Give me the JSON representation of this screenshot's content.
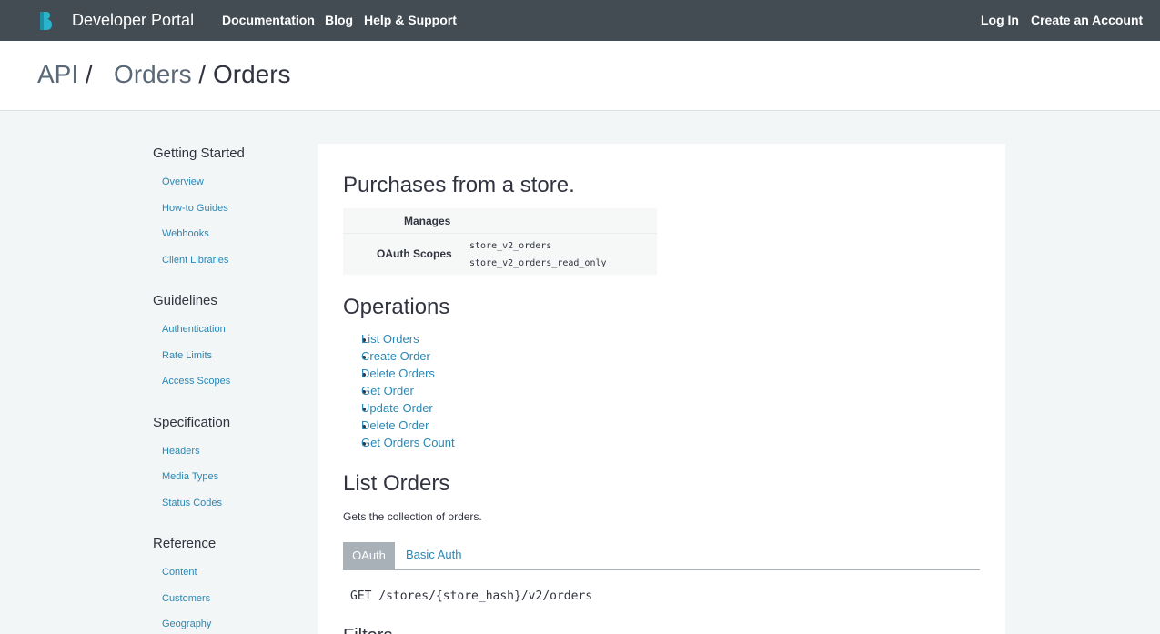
{
  "nav": {
    "brand": "Developer Portal",
    "links": [
      "Documentation",
      "Blog",
      "Help & Support"
    ],
    "login": "Log In",
    "create_account": "Create an Account"
  },
  "breadcrumb": {
    "api": "API",
    "sep": "/",
    "section": "Orders",
    "current": "Orders"
  },
  "sidebar": {
    "groups": [
      {
        "title": "Getting Started",
        "items": [
          "Overview",
          "How-to Guides",
          "Webhooks",
          "Client Libraries"
        ]
      },
      {
        "title": "Guidelines",
        "items": [
          "Authentication",
          "Rate Limits",
          "Access Scopes"
        ]
      },
      {
        "title": "Specification",
        "items": [
          "Headers",
          "Media Types",
          "Status Codes"
        ]
      },
      {
        "title": "Reference",
        "items": [
          "Content",
          "Customers",
          "Geography"
        ]
      }
    ]
  },
  "main": {
    "title": "Purchases from a store.",
    "meta": {
      "manages_label": "Manages",
      "scopes_label": "OAuth Scopes",
      "scopes": [
        "store_v2_orders",
        "store_v2_orders_read_only"
      ]
    },
    "operations_title": "Operations",
    "operations": [
      "List Orders",
      "Create Order",
      "Delete Orders",
      "Get Order",
      "Update Order",
      "Delete Order",
      "Get Orders Count"
    ],
    "list_title": "List Orders",
    "list_desc": "Gets the collection of orders.",
    "tabs": [
      "OAuth",
      "Basic Auth"
    ],
    "endpoint": "GET /stores/{store_hash}/v2/orders",
    "filters_title": "Filters"
  },
  "colors": {
    "topbar": "#434b53",
    "link": "#2b87b5",
    "logo": "#2cb3cc"
  },
  "icons": {
    "logo": "brand-logo-icon"
  }
}
